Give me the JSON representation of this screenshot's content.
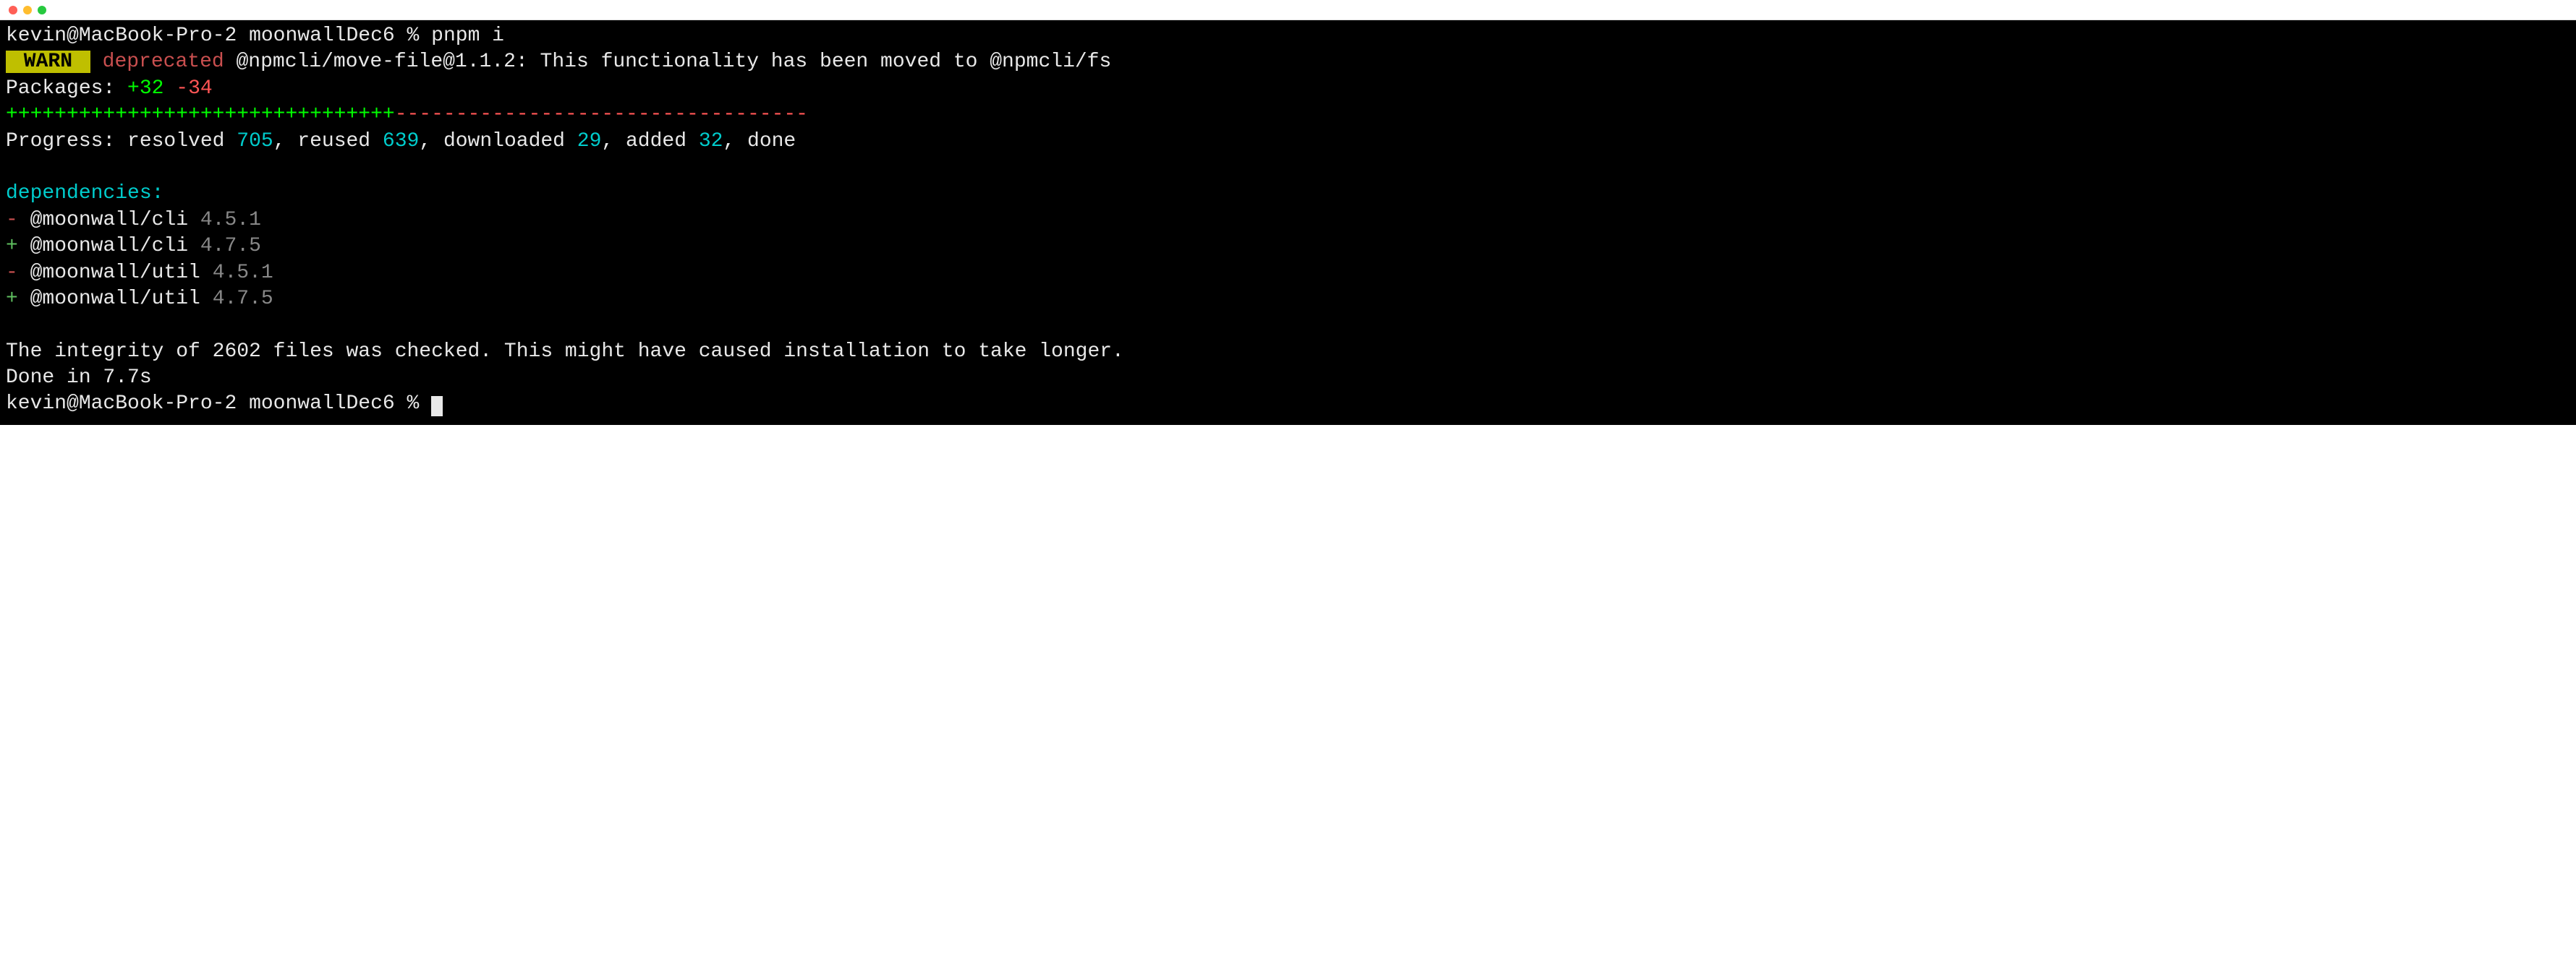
{
  "prompt1": {
    "user": "kevin",
    "host": "MacBook-Pro-2",
    "cwd": "moonwallDec6",
    "symbol": "%",
    "command": "pnpm i"
  },
  "warn": {
    "badge": " WARN ",
    "label": "deprecated",
    "msg": "@npmcli/move-file@1.1.2: This functionality has been moved to @npmcli/fs"
  },
  "packages": {
    "label": "Packages:",
    "add": "+32",
    "remove": "-34"
  },
  "bar": {
    "plus": "++++++++++++++++++++++++++++++++",
    "minus": "----------------------------------"
  },
  "progress": {
    "label": "Progress: resolved ",
    "resolved": "705",
    "reusedLabel": ", reused ",
    "reused": "639",
    "downloadedLabel": ", downloaded ",
    "downloaded": "29",
    "addedLabel": ", added ",
    "added": "32",
    "doneLabel": ", done"
  },
  "deps": {
    "header": "dependencies:",
    "rows": [
      {
        "sign": "-",
        "name": "@moonwall/cli",
        "ver": "4.5.1",
        "signClass": "red"
      },
      {
        "sign": "+",
        "name": "@moonwall/cli",
        "ver": "4.7.5",
        "signClass": "green"
      },
      {
        "sign": "-",
        "name": "@moonwall/util",
        "ver": "4.5.1",
        "signClass": "red"
      },
      {
        "sign": "+",
        "name": "@moonwall/util",
        "ver": "4.7.5",
        "signClass": "green"
      }
    ]
  },
  "integrity": "The integrity of 2602 files was checked. This might have caused installation to take longer.",
  "done": "Done in 7.7s",
  "prompt2": {
    "user": "kevin",
    "host": "MacBook-Pro-2",
    "cwd": "moonwallDec6",
    "symbol": "%"
  }
}
